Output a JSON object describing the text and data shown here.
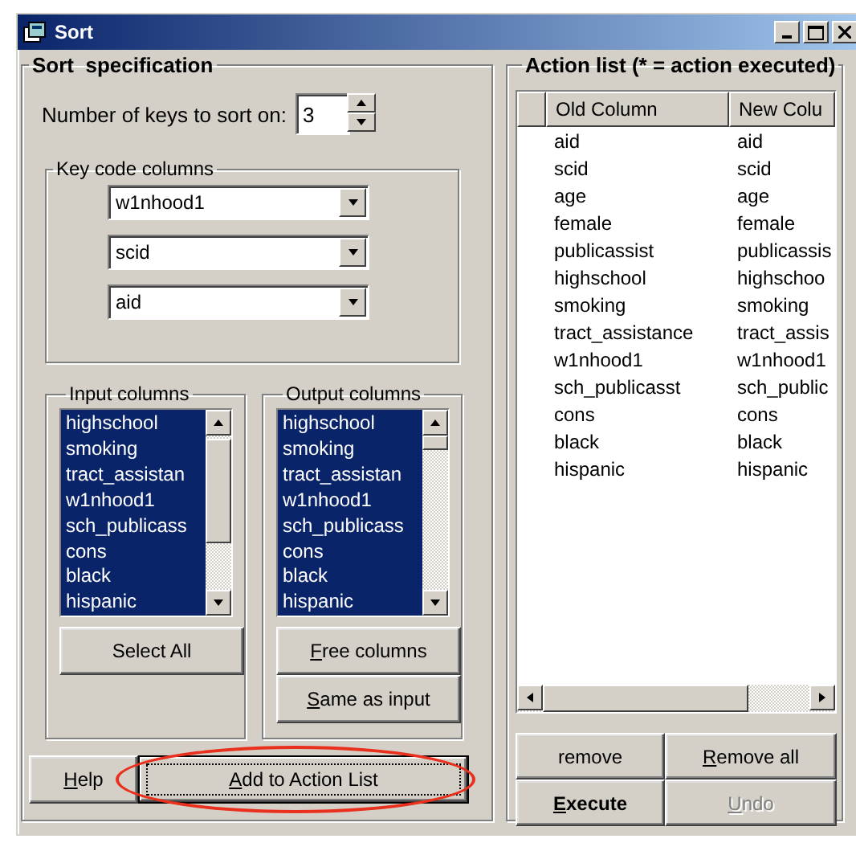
{
  "window": {
    "title": "Sort"
  },
  "sort_specification": {
    "title": "Sort  specification",
    "keys_label": "Number of keys to sort on:",
    "keys_value": "3",
    "key_columns": {
      "title": "Key code columns",
      "combos": [
        "w1nhood1",
        "scid",
        "aid"
      ]
    },
    "input_columns": {
      "title": "Input columns",
      "items": [
        {
          "label": "highschool",
          "selected": true
        },
        {
          "label": "smoking",
          "selected": true
        },
        {
          "label": "tract_assistan",
          "selected": true
        },
        {
          "label": "w1nhood1",
          "selected": true
        },
        {
          "label": "sch_publicass",
          "selected": true
        },
        {
          "label": "cons",
          "selected": true
        },
        {
          "label": "black",
          "selected": true
        },
        {
          "label": "hispanic",
          "selected": true
        }
      ],
      "buttons": [
        {
          "label": "Select All",
          "underline_first": false,
          "bold": false,
          "disabled": false,
          "default": false,
          "circled": false
        }
      ]
    },
    "output_columns": {
      "title": "Output columns",
      "items": [
        {
          "label": "highschool",
          "selected": true
        },
        {
          "label": "smoking",
          "selected": true
        },
        {
          "label": "tract_assistan",
          "selected": true
        },
        {
          "label": "w1nhood1",
          "selected": true
        },
        {
          "label": "sch_publicass",
          "selected": true
        },
        {
          "label": "cons",
          "selected": true
        },
        {
          "label": "black",
          "selected": true
        },
        {
          "label": "hispanic",
          "selected": true
        }
      ],
      "buttons": [
        {
          "label": "Free columns",
          "underline_first": true,
          "bold": false,
          "disabled": false,
          "default": false,
          "circled": false
        },
        {
          "label": "Same as input",
          "underline_first": true,
          "bold": false,
          "disabled": false,
          "default": false,
          "circled": false
        }
      ]
    },
    "buttons": [
      {
        "label": "Help",
        "underline_first": true,
        "bold": false,
        "disabled": false,
        "default": false,
        "circled": false
      },
      {
        "label": "Add to Action List",
        "underline_first": true,
        "bold": false,
        "disabled": false,
        "default": true,
        "circled": true
      }
    ]
  },
  "action_list": {
    "title": "Action list (* = action executed)",
    "columns": [
      "Old Column",
      "New Colu"
    ],
    "rows": [
      [
        "aid",
        "aid"
      ],
      [
        "scid",
        "scid"
      ],
      [
        "age",
        "age"
      ],
      [
        "female",
        "female"
      ],
      [
        "publicassist",
        "publicassis"
      ],
      [
        "highschool",
        "highschoo"
      ],
      [
        "smoking",
        "smoking"
      ],
      [
        "tract_assistance",
        "tract_assis"
      ],
      [
        "w1nhood1",
        "w1nhood1"
      ],
      [
        "sch_publicasst",
        "sch_public"
      ],
      [
        "cons",
        "cons"
      ],
      [
        "black",
        "black"
      ],
      [
        "hispanic",
        "hispanic"
      ]
    ],
    "buttons": [
      {
        "label": "remove",
        "underline_first": false,
        "bold": false,
        "disabled": false,
        "default": false,
        "circled": false
      },
      {
        "label": "Remove all",
        "underline_first": true,
        "bold": false,
        "disabled": false,
        "default": false,
        "circled": false
      },
      {
        "label": "Execute",
        "underline_first": true,
        "bold": true,
        "disabled": false,
        "default": false,
        "circled": false
      },
      {
        "label": "Undo",
        "underline_first": true,
        "bold": false,
        "disabled": true,
        "default": false,
        "circled": false
      }
    ]
  }
}
